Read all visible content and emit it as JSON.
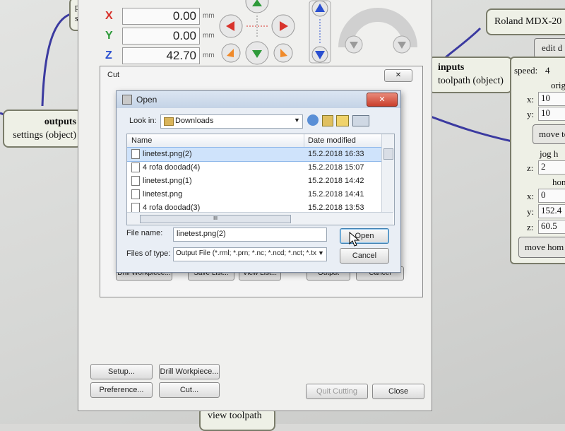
{
  "background_app": {
    "coords": {
      "x_label": "X",
      "x_value": "0.00",
      "x_unit": "mm",
      "y_label": "Y",
      "y_value": "0.00",
      "y_unit": "mm",
      "z_label": "Z",
      "z_value": "42.70",
      "z_unit": "mm"
    },
    "nodes": {
      "top_left_partial_1": "pa",
      "top_left_partial_2": "se",
      "outputs_title": "outputs",
      "outputs_sub": "settings (object)",
      "inputs_title": "inputs",
      "inputs_sub": "toolpath (object)",
      "roland_title": "Roland MDX-20",
      "edit_label": "edit d",
      "view_toolpath": "view toolpath"
    },
    "roland_panel": {
      "speed_label": "speed:",
      "speed_value": "4",
      "origin_label": "orig",
      "ox_label": "x:",
      "ox_value": "10",
      "oy_label": "y:",
      "oy_value": "10",
      "move_to_button": "move to",
      "jog_label": "jog h",
      "jz_label": "z:",
      "jz_value": "2",
      "home_label": "hom",
      "hx_label": "x:",
      "hx_value": "0",
      "hy_label": "y:",
      "hy_value": "152.4",
      "hz_label": "z:",
      "hz_value": "60.5",
      "move_home_button": "move hom"
    }
  },
  "cut_window": {
    "title": "Cut",
    "close_glyph": "✕",
    "hidden_buttons": [
      "Drill Workpiece...",
      "Save List...",
      "View List...",
      "Output",
      "Cancel"
    ],
    "buttons": {
      "setup": "Setup...",
      "drill_workpiece": "Drill Workpiece...",
      "preference": "Preference...",
      "cut": "Cut...",
      "quit_cutting": "Quit Cutting",
      "close": "Close"
    }
  },
  "open_dialog": {
    "title": "Open",
    "close_glyph": "✕",
    "look_in_label": "Look in:",
    "look_in_value": "Downloads",
    "columns": {
      "name": "Name",
      "date": "Date modified"
    },
    "files": [
      {
        "name": "linetest.png(2)",
        "date": "15.2.2018 16:33",
        "selected": true
      },
      {
        "name": "4 rofa doodad(4)",
        "date": "15.2.2018 15:07",
        "selected": false
      },
      {
        "name": "linetest.png(1)",
        "date": "15.2.2018 14:42",
        "selected": false
      },
      {
        "name": "linetest.png",
        "date": "15.2.2018 14:41",
        "selected": false
      },
      {
        "name": "4 rofa doodad(3)",
        "date": "15.2.2018 13:53",
        "selected": false
      }
    ],
    "hscroll_grip": "III",
    "file_name_label": "File name:",
    "file_name_value": "linetest.png(2)",
    "file_type_label": "Files of type:",
    "file_type_value": "Output File (*.rml; *.prn; *.nc; *.ncd; *.nct; *.tx",
    "open_button": "Open",
    "cancel_button": "Cancel"
  },
  "colors": {
    "x_color": "#d8332c",
    "y_color": "#2e9a3a",
    "z_color": "#2a4fd0",
    "selection": "#cfe3fb",
    "wire": "#3b3aa0"
  }
}
